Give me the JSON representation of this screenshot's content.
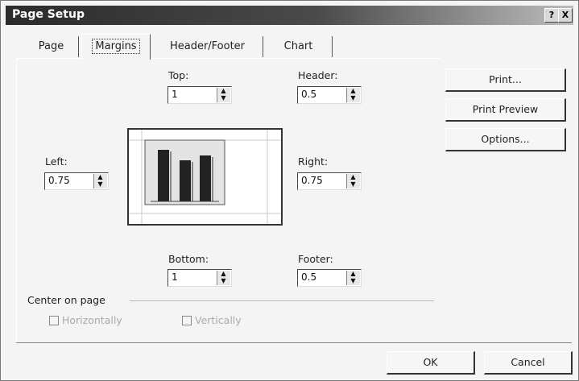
{
  "dialog": {
    "title": "Page Setup",
    "help_label": "?",
    "close_label": "X"
  },
  "tabs": [
    {
      "label": "Page",
      "active": false
    },
    {
      "label": "Margins",
      "active": true
    },
    {
      "label": "Header/Footer",
      "active": false
    },
    {
      "label": "Chart",
      "active": false
    }
  ],
  "margins": {
    "top": {
      "label": "Top:",
      "value": "1"
    },
    "header": {
      "label": "Header:",
      "value": "0.5"
    },
    "left": {
      "label": "Left:",
      "value": "0.75"
    },
    "right": {
      "label": "Right:",
      "value": "0.75"
    },
    "bottom": {
      "label": "Bottom:",
      "value": "1"
    },
    "footer": {
      "label": "Footer:",
      "value": "0.5"
    }
  },
  "center_on_page": {
    "label": "Center on page",
    "horizontally": {
      "label": "Horizontally",
      "checked": false,
      "enabled": false
    },
    "vertically": {
      "label": "Vertically",
      "checked": false,
      "enabled": false
    }
  },
  "side_buttons": {
    "print": "Print...",
    "print_preview": "Print Preview",
    "options": "Options..."
  },
  "footer_buttons": {
    "ok": "OK",
    "cancel": "Cancel"
  },
  "colors": {
    "titlebar_dark": "#2b2b2b",
    "dialog_bg": "#f4f4f4",
    "bar_dark": "#222222"
  }
}
